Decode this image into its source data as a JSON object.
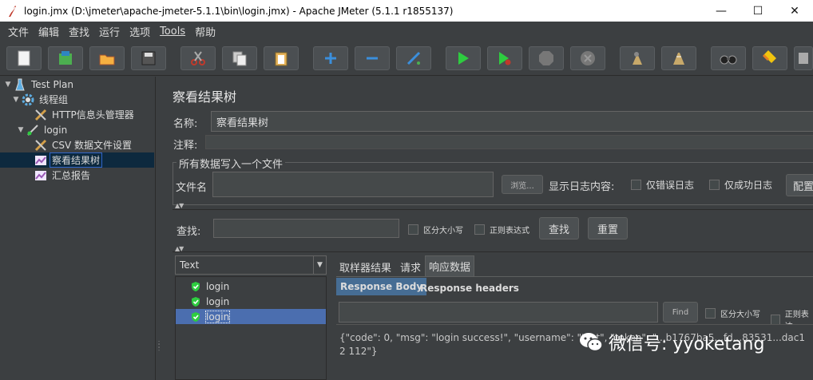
{
  "window": {
    "title": "login.jmx (D:\\jmeter\\apache-jmeter-5.1.1\\bin\\login.jmx) - Apache JMeter (5.1.1 r1855137)",
    "minimize": "—",
    "maximize": "☐",
    "close": "✕"
  },
  "menu": [
    "文件",
    "编辑",
    "查找",
    "运行",
    "选项",
    "Tools",
    "帮助"
  ],
  "toolbar": [
    {
      "name": "new-icon"
    },
    {
      "name": "templates-icon"
    },
    {
      "name": "open-icon"
    },
    {
      "name": "save-icon"
    },
    {
      "name": "cut-icon"
    },
    {
      "name": "copy-icon"
    },
    {
      "name": "paste-icon"
    },
    {
      "name": "expand-icon"
    },
    {
      "name": "collapse-icon"
    },
    {
      "name": "toggle-icon"
    },
    {
      "name": "start-icon"
    },
    {
      "name": "start-no-pause-icon"
    },
    {
      "name": "stop-icon"
    },
    {
      "name": "shutdown-icon"
    },
    {
      "name": "clear-icon"
    },
    {
      "name": "clear-all-icon"
    },
    {
      "name": "search-icon"
    },
    {
      "name": "reset-search-icon"
    },
    {
      "name": "function-helper-icon"
    }
  ],
  "tree": [
    {
      "label": "Test Plan",
      "icon": "testplan-icon",
      "depth": 0,
      "twisty": "▼"
    },
    {
      "label": "线程组",
      "icon": "gear-icon",
      "depth": 1,
      "twisty": "▼"
    },
    {
      "label": "HTTP信息头管理器",
      "icon": "tools-icon",
      "depth": 2,
      "twisty": ""
    },
    {
      "label": "login",
      "icon": "sampler-icon",
      "depth": 2,
      "twisty": "▼"
    },
    {
      "label": "CSV 数据文件设置",
      "icon": "tools-icon",
      "depth": 3,
      "twisty": ""
    },
    {
      "label": "察看结果树",
      "icon": "chart-icon",
      "depth": 3,
      "twisty": "",
      "selected": true
    },
    {
      "label": "汇总报告",
      "icon": "chart-icon",
      "depth": 3,
      "twisty": ""
    }
  ],
  "panel": {
    "title": "察看结果树",
    "name_label": "名称:",
    "name_value": "察看结果树",
    "comment_label": "注释:",
    "comment_value": "",
    "fileset_legend": "所有数据写入一个文件",
    "filename_label": "文件名",
    "filename_value": "",
    "browse": "浏览...",
    "log_content": "显示日志内容:",
    "errors_only": "仅错误日志",
    "success_only": "仅成功日志",
    "configure": "配置",
    "search_label": "查找:",
    "case_sensitive": "区分大小写",
    "regex": "正则表达式",
    "search_button": "查找",
    "reset_button": "重置"
  },
  "results": {
    "renderer": "Text",
    "items": [
      {
        "label": "login",
        "selected": false
      },
      {
        "label": "login",
        "selected": false
      },
      {
        "label": "login",
        "selected": true
      }
    ]
  },
  "tabs": {
    "items": [
      "取样器结果",
      "请求",
      "响应数据"
    ],
    "active": 2,
    "subtabs": [
      "Response Body",
      "Response headers"
    ],
    "active_sub": 0,
    "find_button": "Find",
    "case_sensitive": "区分大小写",
    "regex": "正则表达",
    "response_text": "{\"code\": 0, \"msg\": \"login success!\", \"username\": \"test\", \"token\": \"...b1767ba5...fd...83531...dac12 112\"}"
  },
  "watermark": "微信号: yyoketang",
  "colors": {
    "accent": "#4b6eaf",
    "background": "#3c3f41",
    "field": "#45494a"
  }
}
